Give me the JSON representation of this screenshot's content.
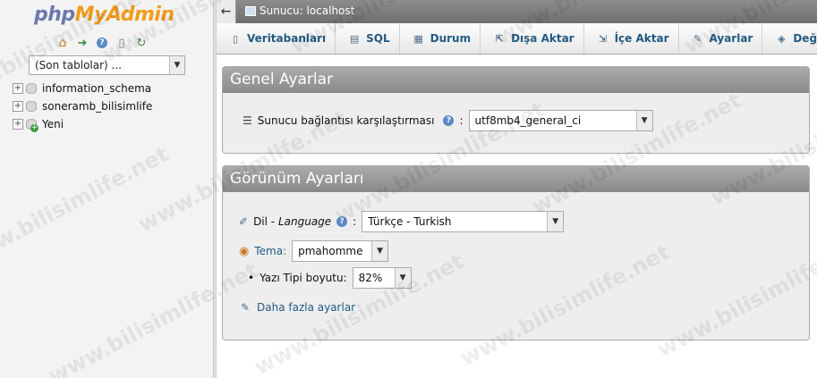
{
  "nav": {
    "logo": {
      "php": "php",
      "my": "My",
      "admin": "Admin"
    },
    "icons": [
      "home-icon",
      "logout-icon",
      "help-icon",
      "docs-icon",
      "reload-icon"
    ],
    "db_select": {
      "value": "(Son tablolar) ..."
    },
    "databases": [
      {
        "name": "information_schema"
      },
      {
        "name": "soneramb_bilisimlife"
      },
      {
        "name": "Yeni"
      }
    ]
  },
  "topbar": {
    "back": "←",
    "server": "Sunucu: localhost"
  },
  "tabs": [
    {
      "label": "Veritabanları",
      "icon": "database-icon",
      "glyph": "▯"
    },
    {
      "label": "SQL",
      "icon": "sql-icon",
      "glyph": "▤"
    },
    {
      "label": "Durum",
      "icon": "status-icon",
      "glyph": "▦"
    },
    {
      "label": "Dışa Aktar",
      "icon": "export-icon",
      "glyph": "⇱"
    },
    {
      "label": "İçe Aktar",
      "icon": "import-icon",
      "glyph": "⇲"
    },
    {
      "label": "Ayarlar",
      "icon": "wrench-icon",
      "glyph": "✎"
    },
    {
      "label": "Değ",
      "icon": "variables-icon",
      "glyph": "◈"
    }
  ],
  "general": {
    "title": "Genel Ayarlar",
    "collation_label": "Sunucu bağlantısı karşılaştırması",
    "collation_value": "utf8mb4_general_ci"
  },
  "appearance": {
    "title": "Görünüm Ayarları",
    "language_label": "Dil - ",
    "language_label_en": "Language",
    "language_value": "Türkçe - Turkish",
    "theme_label": "Tema:",
    "theme_value": "pmahomme",
    "fontsize_label": "Yazı Tipi boyutu:",
    "fontsize_value": "82%",
    "more_settings": "Daha fazla ayarlar"
  },
  "watermark": "www.bilisimlife.net",
  "colors": {
    "link": "#235a81",
    "panel_header": "#8a8a8a",
    "logo_orange": "#f29b1c",
    "logo_blue": "#6c78af"
  }
}
